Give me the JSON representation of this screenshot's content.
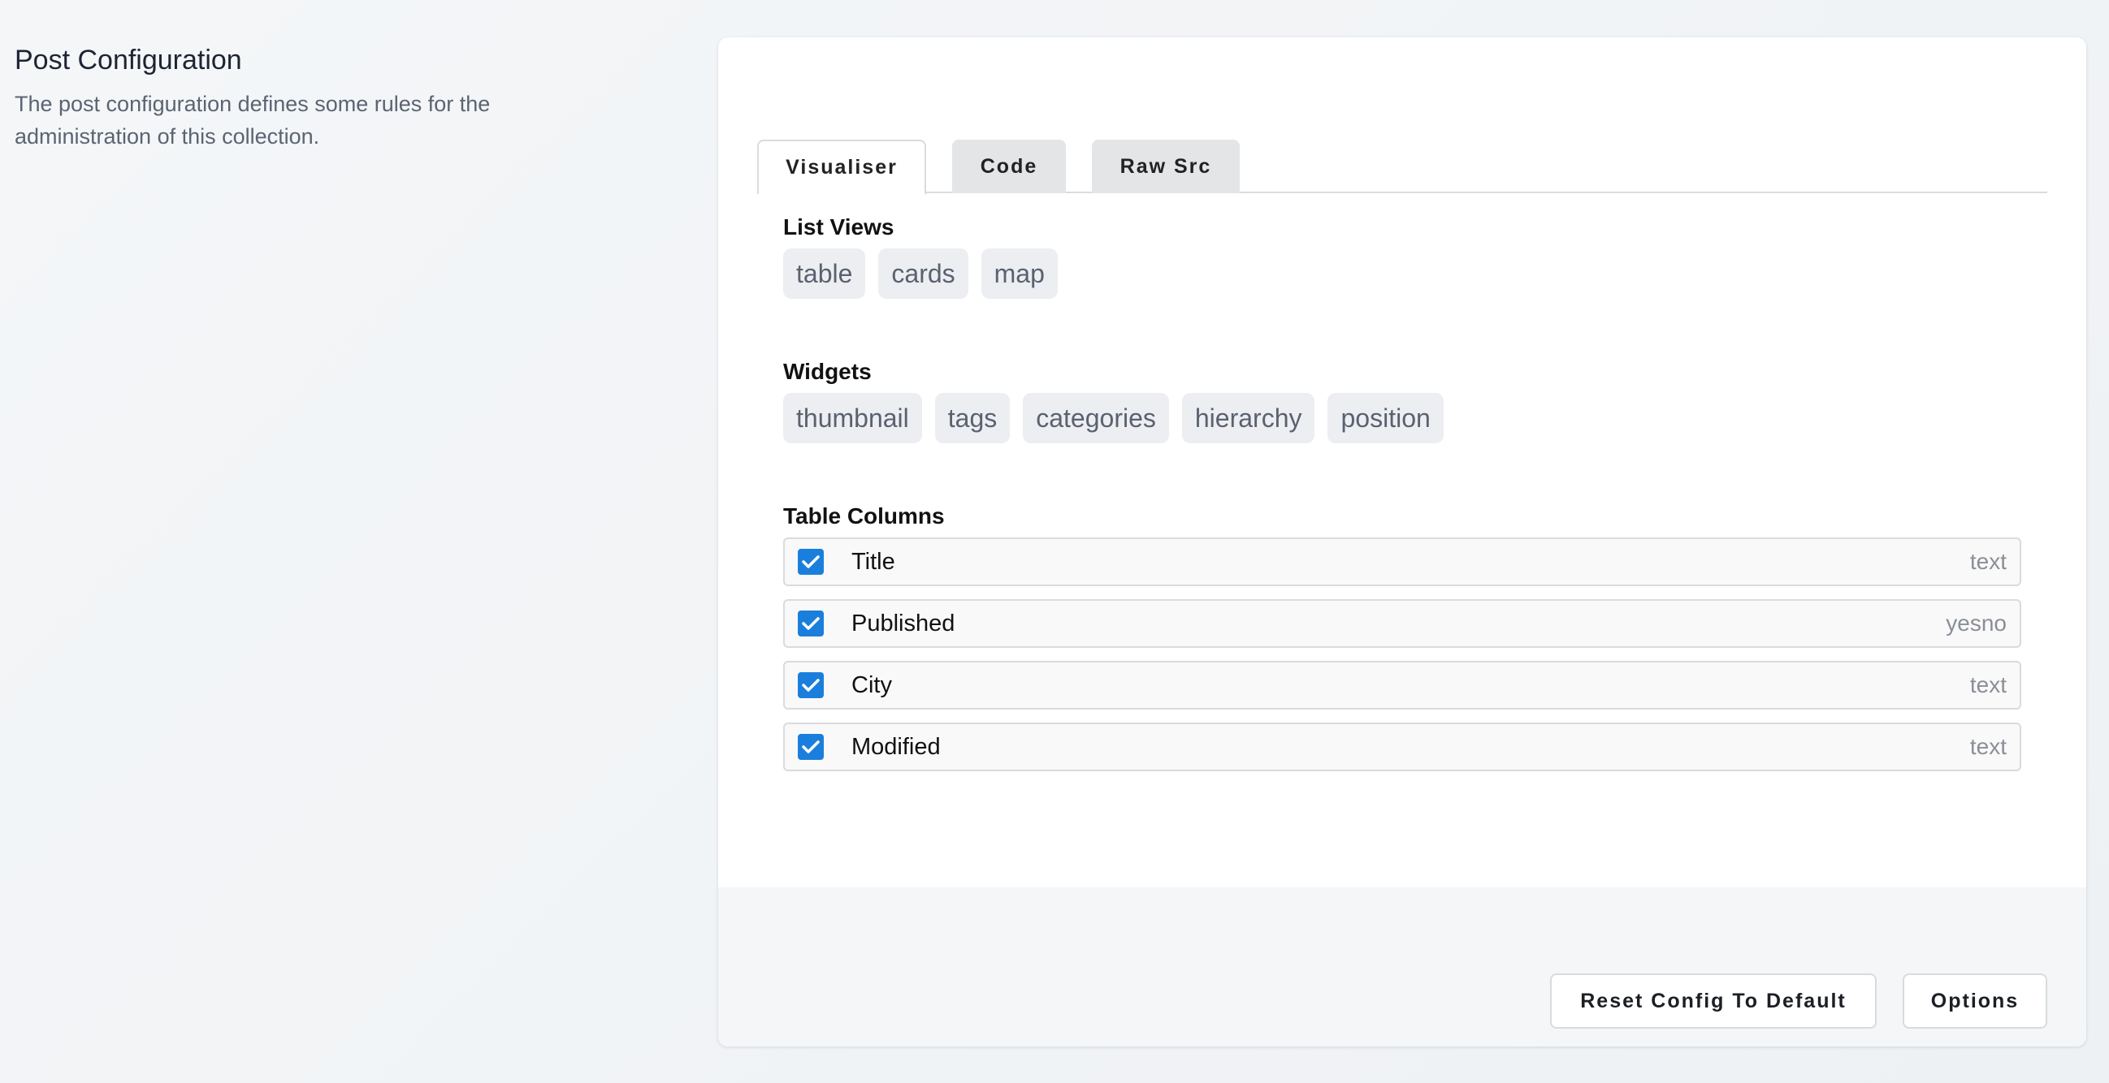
{
  "intro": {
    "title": "Post Configuration",
    "description": "The post configuration defines some rules for the administration of this collection."
  },
  "tabs": [
    {
      "label": "Visualiser",
      "active": true
    },
    {
      "label": "Code",
      "active": false
    },
    {
      "label": "Raw Src",
      "active": false
    }
  ],
  "list_views": {
    "label": "List Views",
    "items": [
      "table",
      "cards",
      "map"
    ]
  },
  "widgets": {
    "label": "Widgets",
    "items": [
      "thumbnail",
      "tags",
      "categories",
      "hierarchy",
      "position"
    ]
  },
  "table_columns": {
    "label": "Table Columns",
    "rows": [
      {
        "name": "Title",
        "type": "text",
        "checked": true
      },
      {
        "name": "Published",
        "type": "yesno",
        "checked": true
      },
      {
        "name": "City",
        "type": "text",
        "checked": true
      },
      {
        "name": "Modified",
        "type": "text",
        "checked": true
      }
    ]
  },
  "footer": {
    "reset_label": "Reset Config To Default",
    "options_label": "Options"
  },
  "colors": {
    "accent": "#1a7fdc",
    "chip_bg": "#eceef1"
  }
}
